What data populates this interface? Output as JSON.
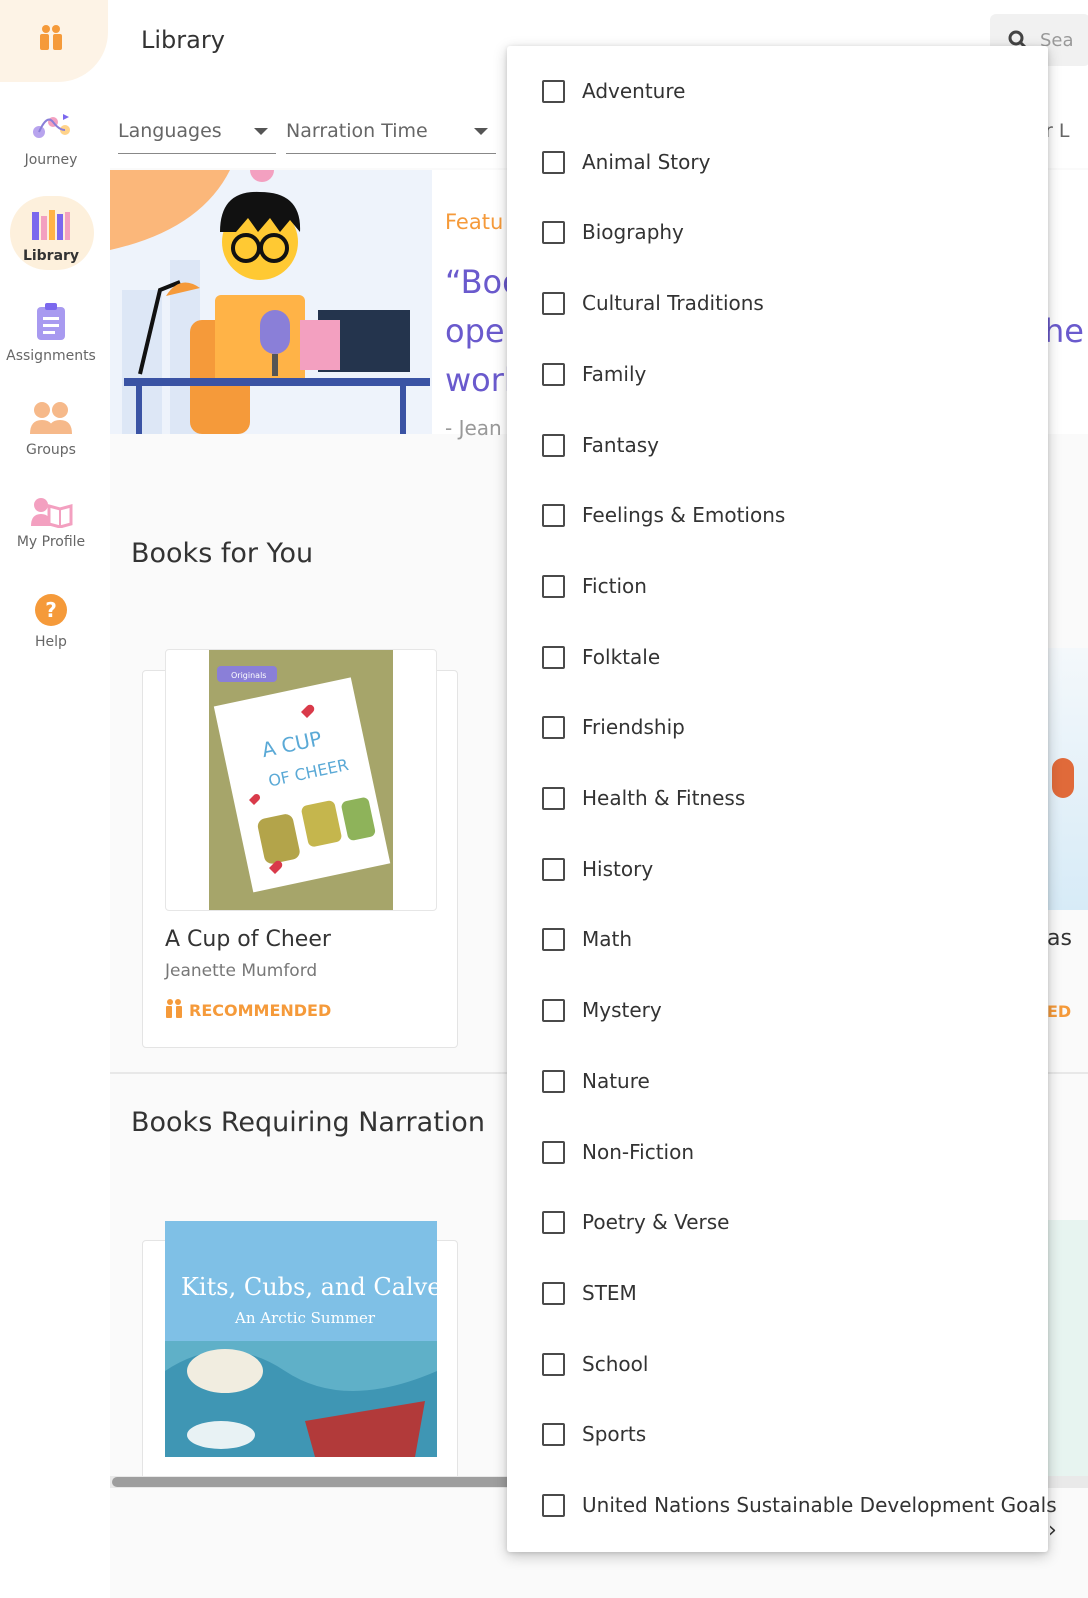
{
  "app": {
    "title": "Library"
  },
  "sidebar": {
    "items": [
      {
        "label": "Journey",
        "icon": "journey-icon"
      },
      {
        "label": "Library",
        "icon": "library-icon",
        "active": true
      },
      {
        "label": "Assignments",
        "icon": "assignments-icon"
      },
      {
        "label": "Groups",
        "icon": "groups-icon"
      },
      {
        "label": "My Profile",
        "icon": "profile-icon"
      },
      {
        "label": "Help",
        "icon": "help-icon"
      }
    ]
  },
  "search": {
    "placeholder": "Sea"
  },
  "filters": {
    "languages": "Languages",
    "narration_time": "Narration Time",
    "right_partial": "r L"
  },
  "hero": {
    "label": "Featu",
    "quote_lines": [
      "“Boo",
      "oper",
      "worl"
    ],
    "quote_right": "he",
    "author": "- Jean"
  },
  "sections": {
    "books_for_you": "Books for You",
    "books_requiring_narration": "Books Requiring Narration"
  },
  "book": {
    "title": "A Cup of Cheer",
    "author": "Jeanette Mumford",
    "badge": "RECOMMENDED",
    "cover_brand": "Originals",
    "cover_title_1": "A CUP",
    "cover_title_2": "OF CHEER"
  },
  "book2": {
    "cover_title_1": "Kits, Cubs, and Calves",
    "cover_title_2": "An Arctic Summer"
  },
  "peek": {
    "title_partial": "as",
    "badge_partial": "ED"
  },
  "dropdown": {
    "options": [
      "Adventure",
      "Animal Story",
      "Biography",
      "Cultural Traditions",
      "Family",
      "Fantasy",
      "Feelings & Emotions",
      "Fiction",
      "Folktale",
      "Friendship",
      "Health & Fitness",
      "History",
      "Math",
      "Mystery",
      "Nature",
      "Non-Fiction",
      "Poetry & Verse",
      "STEM",
      "School",
      "Sports",
      "United Nations Sustainable Development Goals"
    ]
  },
  "colors": {
    "accent": "#f59a3a",
    "quote": "#6a5acd",
    "purple": "#7b68ee"
  }
}
